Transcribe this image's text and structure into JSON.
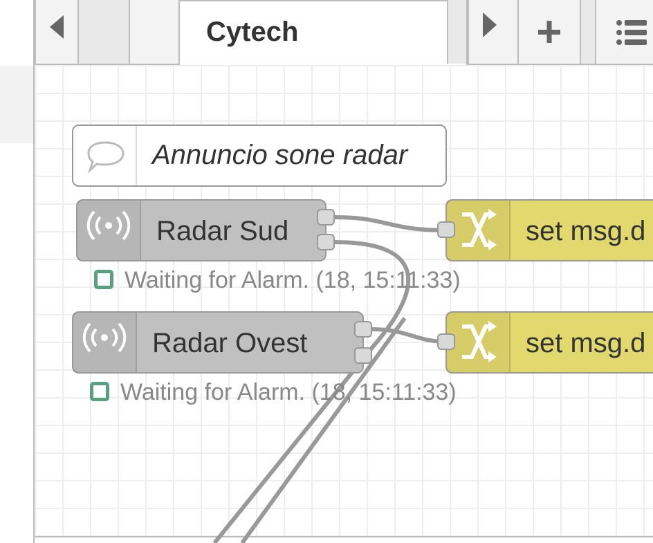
{
  "tabbar": {
    "active_tab": "Cytech",
    "prev_icon": "triangle-left-icon",
    "next_icon": "triangle-right-icon",
    "add_label": "+",
    "menu_icon": "list-icon"
  },
  "comment_node": {
    "label": "Annuncio sone radar",
    "icon": "speech-bubble-icon"
  },
  "nodes": [
    {
      "label": "Radar Sud",
      "icon": "radio-waves-icon",
      "status": "Waiting for Alarm. (18, 15:11:33)"
    },
    {
      "label": "Radar Ovest",
      "icon": "radio-waves-icon",
      "status": "Waiting for Alarm. (18, 15:11:33)"
    }
  ],
  "change_nodes": [
    {
      "label": "set msg.d",
      "icon": "shuffle-icon"
    },
    {
      "label": "set msg.d",
      "icon": "shuffle-icon"
    }
  ],
  "colors": {
    "input_node": "#c0c0c0",
    "change_node": "#e2d96e",
    "status_ok": "#5aa07f",
    "wire": "#999999"
  }
}
